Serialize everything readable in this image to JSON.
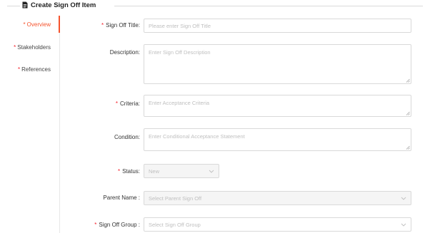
{
  "header": {
    "title": "Create Sign Off Item",
    "icon": "document-icon"
  },
  "colors": {
    "accent": "#f5532d",
    "required": "#f5222d",
    "border": "#d9d9d9",
    "placeholder": "#bfbfbf"
  },
  "sidebar": {
    "items": [
      {
        "label": "Overview",
        "required": "*"
      },
      {
        "label": "Stakeholders",
        "required": "*"
      },
      {
        "label": "References",
        "required": "*"
      }
    ]
  },
  "form": {
    "title": {
      "required": "*",
      "label": "Sign Off Title:",
      "placeholder": "Please enter Sign Off Title"
    },
    "description": {
      "label": "Description:",
      "placeholder": "Enter Sign Off Description"
    },
    "criteria": {
      "required": "*",
      "label": "Criteria:",
      "placeholder": "Enter Acceptance Criteria"
    },
    "condition": {
      "label": "Condition:",
      "placeholder": "Enter Conditional Acceptance Statement"
    },
    "status": {
      "required": "*",
      "label": "Status:",
      "value": "New"
    },
    "parent_name": {
      "label": "Parent Name :",
      "placeholder": "Select Parent Sign Off"
    },
    "sign_off_group": {
      "required": "*",
      "label": "Sign Off Group :",
      "placeholder": "Select Sign Off Group"
    }
  }
}
